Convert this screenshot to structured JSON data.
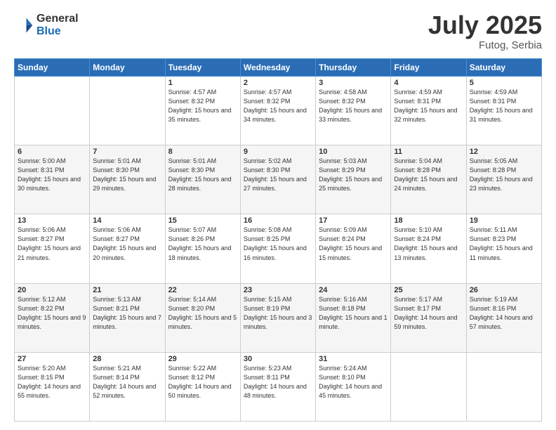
{
  "logo": {
    "general": "General",
    "blue": "Blue"
  },
  "title": {
    "month_year": "July 2025",
    "location": "Futog, Serbia"
  },
  "days_header": [
    "Sunday",
    "Monday",
    "Tuesday",
    "Wednesday",
    "Thursday",
    "Friday",
    "Saturday"
  ],
  "weeks": [
    [
      {
        "day": "",
        "content": ""
      },
      {
        "day": "",
        "content": ""
      },
      {
        "day": "1",
        "content": "Sunrise: 4:57 AM\nSunset: 8:32 PM\nDaylight: 15 hours\nand 35 minutes."
      },
      {
        "day": "2",
        "content": "Sunrise: 4:57 AM\nSunset: 8:32 PM\nDaylight: 15 hours\nand 34 minutes."
      },
      {
        "day": "3",
        "content": "Sunrise: 4:58 AM\nSunset: 8:32 PM\nDaylight: 15 hours\nand 33 minutes."
      },
      {
        "day": "4",
        "content": "Sunrise: 4:59 AM\nSunset: 8:31 PM\nDaylight: 15 hours\nand 32 minutes."
      },
      {
        "day": "5",
        "content": "Sunrise: 4:59 AM\nSunset: 8:31 PM\nDaylight: 15 hours\nand 31 minutes."
      }
    ],
    [
      {
        "day": "6",
        "content": "Sunrise: 5:00 AM\nSunset: 8:31 PM\nDaylight: 15 hours\nand 30 minutes."
      },
      {
        "day": "7",
        "content": "Sunrise: 5:01 AM\nSunset: 8:30 PM\nDaylight: 15 hours\nand 29 minutes."
      },
      {
        "day": "8",
        "content": "Sunrise: 5:01 AM\nSunset: 8:30 PM\nDaylight: 15 hours\nand 28 minutes."
      },
      {
        "day": "9",
        "content": "Sunrise: 5:02 AM\nSunset: 8:30 PM\nDaylight: 15 hours\nand 27 minutes."
      },
      {
        "day": "10",
        "content": "Sunrise: 5:03 AM\nSunset: 8:29 PM\nDaylight: 15 hours\nand 25 minutes."
      },
      {
        "day": "11",
        "content": "Sunrise: 5:04 AM\nSunset: 8:28 PM\nDaylight: 15 hours\nand 24 minutes."
      },
      {
        "day": "12",
        "content": "Sunrise: 5:05 AM\nSunset: 8:28 PM\nDaylight: 15 hours\nand 23 minutes."
      }
    ],
    [
      {
        "day": "13",
        "content": "Sunrise: 5:06 AM\nSunset: 8:27 PM\nDaylight: 15 hours\nand 21 minutes."
      },
      {
        "day": "14",
        "content": "Sunrise: 5:06 AM\nSunset: 8:27 PM\nDaylight: 15 hours\nand 20 minutes."
      },
      {
        "day": "15",
        "content": "Sunrise: 5:07 AM\nSunset: 8:26 PM\nDaylight: 15 hours\nand 18 minutes."
      },
      {
        "day": "16",
        "content": "Sunrise: 5:08 AM\nSunset: 8:25 PM\nDaylight: 15 hours\nand 16 minutes."
      },
      {
        "day": "17",
        "content": "Sunrise: 5:09 AM\nSunset: 8:24 PM\nDaylight: 15 hours\nand 15 minutes."
      },
      {
        "day": "18",
        "content": "Sunrise: 5:10 AM\nSunset: 8:24 PM\nDaylight: 15 hours\nand 13 minutes."
      },
      {
        "day": "19",
        "content": "Sunrise: 5:11 AM\nSunset: 8:23 PM\nDaylight: 15 hours\nand 11 minutes."
      }
    ],
    [
      {
        "day": "20",
        "content": "Sunrise: 5:12 AM\nSunset: 8:22 PM\nDaylight: 15 hours\nand 9 minutes."
      },
      {
        "day": "21",
        "content": "Sunrise: 5:13 AM\nSunset: 8:21 PM\nDaylight: 15 hours\nand 7 minutes."
      },
      {
        "day": "22",
        "content": "Sunrise: 5:14 AM\nSunset: 8:20 PM\nDaylight: 15 hours\nand 5 minutes."
      },
      {
        "day": "23",
        "content": "Sunrise: 5:15 AM\nSunset: 8:19 PM\nDaylight: 15 hours\nand 3 minutes."
      },
      {
        "day": "24",
        "content": "Sunrise: 5:16 AM\nSunset: 8:18 PM\nDaylight: 15 hours\nand 1 minute."
      },
      {
        "day": "25",
        "content": "Sunrise: 5:17 AM\nSunset: 8:17 PM\nDaylight: 14 hours\nand 59 minutes."
      },
      {
        "day": "26",
        "content": "Sunrise: 5:19 AM\nSunset: 8:16 PM\nDaylight: 14 hours\nand 57 minutes."
      }
    ],
    [
      {
        "day": "27",
        "content": "Sunrise: 5:20 AM\nSunset: 8:15 PM\nDaylight: 14 hours\nand 55 minutes."
      },
      {
        "day": "28",
        "content": "Sunrise: 5:21 AM\nSunset: 8:14 PM\nDaylight: 14 hours\nand 52 minutes."
      },
      {
        "day": "29",
        "content": "Sunrise: 5:22 AM\nSunset: 8:12 PM\nDaylight: 14 hours\nand 50 minutes."
      },
      {
        "day": "30",
        "content": "Sunrise: 5:23 AM\nSunset: 8:11 PM\nDaylight: 14 hours\nand 48 minutes."
      },
      {
        "day": "31",
        "content": "Sunrise: 5:24 AM\nSunset: 8:10 PM\nDaylight: 14 hours\nand 45 minutes."
      },
      {
        "day": "",
        "content": ""
      },
      {
        "day": "",
        "content": ""
      }
    ]
  ]
}
